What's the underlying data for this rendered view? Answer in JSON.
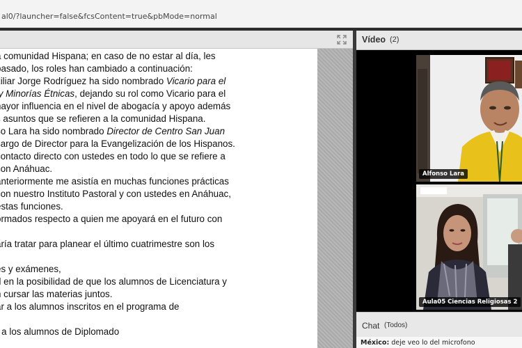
{
  "browser": {
    "url": "al0/?launcher=false&fcsContent=true&pbMode=normal"
  },
  "document": {
    "lines": [
      "a comunidad Hispana; en caso de no estar al día, les",
      "pasado, los roles han cambiado a continuación:",
      "xiliar Jorge Rodríguez ha sido nombrado ",
      "Vicario para el",
      " y Minorías Étnicas",
      ", dejando su rol como Vicario para el",
      "nayor influencia en el nivel de abogacía y apoyo además",
      "s asuntos que se refieren a la comunidad Hispana.",
      "so Lara ha sido nombrado ",
      "Director de Centro San Juan",
      "cargo de Director para la Evangelización de los Hispanos.",
      "contacto directo con ustedes en todo lo que se refiere a",
      "con Anáhuac.",
      "anteriormente me asistía en muchas funciones prácticas",
      "con nuestro Instituto Pastoral y con ustedes en Anáhuac,",
      "estas funciones.",
      "ormados respecto a quien me apoyará en el futuro con",
      "aría tratar para planear el último cuatrimestre son los",
      "es y exámenes,",
      "d en la posibilidad de que los alumnos de Licenciatura y",
      "n cursar las materias juntos.",
      "ar a los alumnos inscritos en el programa de",
      "r a los alumnos de Diplomado"
    ]
  },
  "video_pod": {
    "title": "Vídeo",
    "count": "(2)",
    "participants": [
      {
        "name": "Alfonso Lara"
      },
      {
        "name": "Aula05 Ciencias Religiosas 2"
      }
    ]
  },
  "chat_pod": {
    "title": "Chat",
    "scope": "(Todos)",
    "message": {
      "sender": "México:",
      "text": " deje veo lo del microfono"
    }
  },
  "icons": {
    "expand": "expand-icon"
  }
}
